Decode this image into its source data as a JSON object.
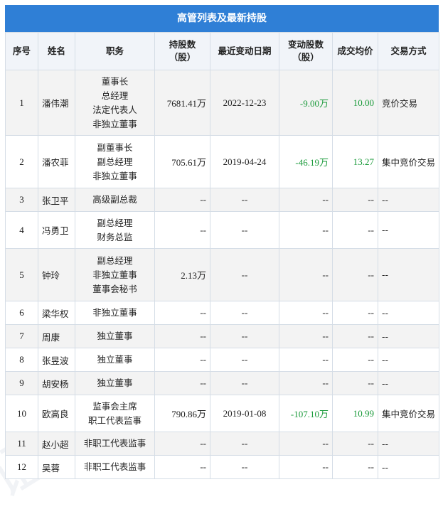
{
  "title": "高管列表及最新持股",
  "headers": {
    "seq": "序号",
    "name": "姓名",
    "position": "职务",
    "shares_line1": "持股数",
    "shares_line2": "（股）",
    "date": "最近变动日期",
    "change_line1": "变动股数",
    "change_line2": "（股）",
    "price": "成交均价",
    "method": "交易方式"
  },
  "rows": [
    {
      "seq": "1",
      "name": "潘伟潮",
      "positions": [
        "董事长",
        "总经理",
        "法定代表人",
        "非独立董事"
      ],
      "shares": "7681.41万",
      "date": "2022-12-23",
      "change": "-9.00万",
      "price": "10.00",
      "method": "竞价交易"
    },
    {
      "seq": "2",
      "name": "潘农菲",
      "positions": [
        "副董事长",
        "副总经理",
        "非独立董事"
      ],
      "shares": "705.61万",
      "date": "2019-04-24",
      "change": "-46.19万",
      "price": "13.27",
      "method": "集中竞价交易"
    },
    {
      "seq": "3",
      "name": "张卫平",
      "positions": [
        "高级副总裁"
      ],
      "shares": "--",
      "date": "--",
      "change": "--",
      "price": "--",
      "method": "--"
    },
    {
      "seq": "4",
      "name": "冯勇卫",
      "positions": [
        "副总经理",
        "财务总监"
      ],
      "shares": "--",
      "date": "--",
      "change": "--",
      "price": "--",
      "method": "--"
    },
    {
      "seq": "5",
      "name": "钟玲",
      "positions": [
        "副总经理",
        "非独立董事",
        "董事会秘书"
      ],
      "shares": "2.13万",
      "date": "--",
      "change": "--",
      "price": "--",
      "method": "--"
    },
    {
      "seq": "6",
      "name": "梁华权",
      "positions": [
        "非独立董事"
      ],
      "shares": "--",
      "date": "--",
      "change": "--",
      "price": "--",
      "method": "--"
    },
    {
      "seq": "7",
      "name": "周康",
      "positions": [
        "独立董事"
      ],
      "shares": "--",
      "date": "--",
      "change": "--",
      "price": "--",
      "method": "--"
    },
    {
      "seq": "8",
      "name": "张昱波",
      "positions": [
        "独立董事"
      ],
      "shares": "--",
      "date": "--",
      "change": "--",
      "price": "--",
      "method": "--"
    },
    {
      "seq": "9",
      "name": "胡安杨",
      "positions": [
        "独立董事"
      ],
      "shares": "--",
      "date": "--",
      "change": "--",
      "price": "--",
      "method": "--"
    },
    {
      "seq": "10",
      "name": "欧高良",
      "positions": [
        "监事会主席",
        "职工代表监事"
      ],
      "shares": "790.86万",
      "date": "2019-01-08",
      "change": "-107.10万",
      "price": "10.99",
      "method": "集中竞价交易"
    },
    {
      "seq": "11",
      "name": "赵小超",
      "positions": [
        "非职工代表监事"
      ],
      "shares": "--",
      "date": "--",
      "change": "--",
      "price": "--",
      "method": "--"
    },
    {
      "seq": "12",
      "name": "吴蓉",
      "positions": [
        "非职工代表监事"
      ],
      "shares": "--",
      "date": "--",
      "change": "--",
      "price": "--",
      "method": "--"
    }
  ],
  "row_heights": [],
  "colors": {
    "header_bar": "#2f7fd6",
    "change_text": "#1a9a3a",
    "price_text": "#1a9a3a"
  }
}
